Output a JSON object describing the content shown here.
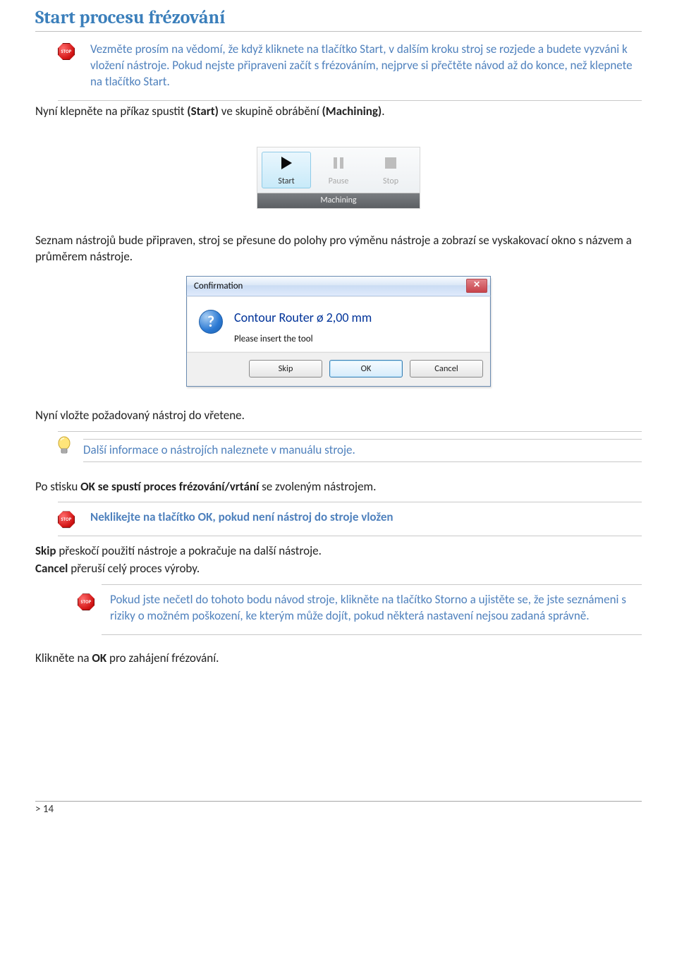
{
  "heading": "Start procesu frézování",
  "stop1": "Vezměte prosím na vědomí, že když kliknete na tlačítko Start, v dalším kroku stroj se rozjede a budete vyzváni k vložení nástroje. Pokud nejste připraveni začít s frézováním, nejprve si přečtěte návod až do konce, než klepnete na tlačítko Start.",
  "line1_a": "Nyní klepněte na příkaz spustit ",
  "line1_b": "(Start)",
  "line1_c": " ve skupině obrábění ",
  "line1_d": "(Machining)",
  "line1_e": ".",
  "toolbar": {
    "start": "Start",
    "pause": "Pause",
    "stop": "Stop",
    "group": "Machining"
  },
  "para2": "Seznam nástrojů bude připraven, stroj se přesune do polohy pro výměnu nástroje a zobrazí se vyskakovací okno s názvem a průměrem nástroje.",
  "dialog": {
    "title": "Confirmation",
    "main": "Contour Router ø 2,00 mm",
    "sub": "Please insert the tool",
    "skip": "Skip",
    "ok": "OK",
    "cancel": "Cancel"
  },
  "para3": "Nyní vložte požadovaný nástroj do vřetene.",
  "tip": "Další informace o nástrojích naleznete v manuálu stroje.",
  "para4_a": "Po stisku ",
  "para4_b": "OK se spustí proces frézování/vrtání",
  "para4_c": " se zvoleným nástrojem.",
  "stop2": "Neklikejte na tlačítko OK, pokud není nástroj do stroje vložen",
  "para5_a": "Skip",
  "para5_b": " přeskočí použití nástroje a pokračuje na další nástroje.",
  "para6_a": "Cancel",
  "para6_b": " přeruší celý proces výroby.",
  "stop3": "Pokud jste nečetl do tohoto bodu návod stroje, klikněte na tlačítko Storno a ujistěte se, že jste seznámeni s riziky o možném poškození,  ke kterým může dojít, pokud některá nastavení nejsou zadaná správně.",
  "para7_a": "Klikněte na ",
  "para7_b": "OK",
  "para7_c": " pro zahájení frézování.",
  "footer": "> 14"
}
